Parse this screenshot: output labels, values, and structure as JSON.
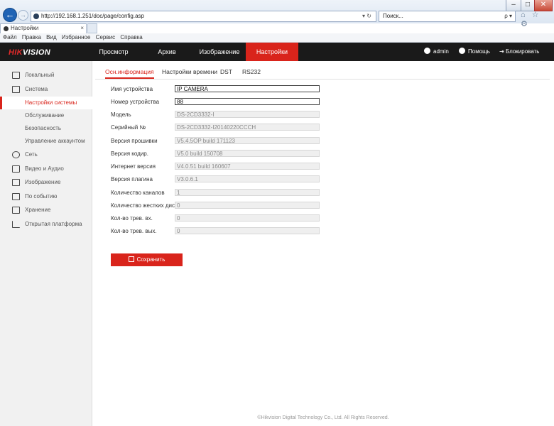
{
  "browser": {
    "address": "http://192.168.1.251/doc/page/config.asp",
    "address_controls": "▾ ↻",
    "search_placeholder": "Поиск...",
    "search_controls": "ρ ▾",
    "tab_title": "Настройки",
    "tab_close": "×",
    "menu": [
      "Файл",
      "Правка",
      "Вид",
      "Избранное",
      "Сервис",
      "Справка"
    ],
    "window_buttons": [
      "–",
      "□",
      "✕"
    ],
    "toolbar_icons": "⌂ ☆ ⚙"
  },
  "app": {
    "logo_main": "HIK",
    "logo_accent": "VISION",
    "nav": [
      "Просмотр",
      "Архив",
      "Изображение",
      "Настройки"
    ],
    "user": "admin",
    "help": "Помощь",
    "lock": "Блокировать"
  },
  "sidebar": {
    "items": [
      {
        "label": "Локальный",
        "icon": "monitor-icon"
      },
      {
        "label": "Система",
        "icon": "system-icon"
      },
      {
        "label": "Настройки системы",
        "icon": ""
      },
      {
        "label": "Обслуживание",
        "icon": ""
      },
      {
        "label": "Безопасность",
        "icon": ""
      },
      {
        "label": "Управление аккаунтом",
        "icon": ""
      },
      {
        "label": "Сеть",
        "icon": "globe-icon"
      },
      {
        "label": "Видео и Аудио",
        "icon": "mic-icon"
      },
      {
        "label": "Изображение",
        "icon": "image-icon"
      },
      {
        "label": "По событию",
        "icon": "calendar-icon"
      },
      {
        "label": "Хранение",
        "icon": "disk-icon"
      },
      {
        "label": "Открытая платформа",
        "icon": "chart-icon"
      }
    ]
  },
  "content": {
    "tabs": [
      "Осн.информация",
      "Настройки времени",
      "DST",
      "RS232"
    ],
    "fields": [
      {
        "label": "Имя устройства",
        "value": "IP CAMERA"
      },
      {
        "label": "Номер устройства",
        "value": "88"
      },
      {
        "label": "Модель",
        "value": "DS-2CD3332-I"
      },
      {
        "label": "Серийный №",
        "value": "DS-2CD3332-I20140220CCCH"
      },
      {
        "label": "Версия прошивки",
        "value": "V5.4.5OP build 171123"
      },
      {
        "label": "Версия кодир.",
        "value": "V5.0 build 150708"
      },
      {
        "label": "Интернет версия",
        "value": "V4.0.51 build 160607"
      },
      {
        "label": "Версия плагина",
        "value": "V3.0.6.1"
      },
      {
        "label": "Количество каналов",
        "value": "1"
      },
      {
        "label": "Количество жестких дис...",
        "value": "0"
      },
      {
        "label": "Кол-во трев. вх.",
        "value": "0"
      },
      {
        "label": "Кол-во трев. вых.",
        "value": "0"
      }
    ],
    "save_label": "Сохранить"
  },
  "footer": "©Hikvision Digital Technology Co., Ltd. All Rights Reserved."
}
